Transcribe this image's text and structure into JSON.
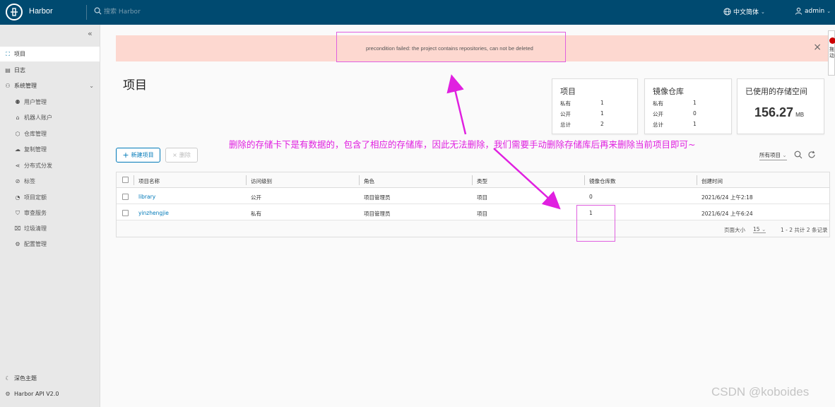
{
  "header": {
    "brand": "Harbor",
    "search_placeholder": "搜索 Harbor",
    "language": "中文简体",
    "user": "admin"
  },
  "sidebar": {
    "items": [
      {
        "label": "项目",
        "icon": "projects-icon"
      },
      {
        "label": "日志",
        "icon": "logs-icon"
      },
      {
        "label": "系统管理",
        "icon": "admin-icon"
      },
      {
        "label": "用户管理",
        "icon": "users-icon"
      },
      {
        "label": "机器人账户",
        "icon": "robot-icon"
      },
      {
        "label": "仓库管理",
        "icon": "registry-icon"
      },
      {
        "label": "复制管理",
        "icon": "replication-icon"
      },
      {
        "label": "分布式分发",
        "icon": "distribution-icon"
      },
      {
        "label": "标签",
        "icon": "label-icon"
      },
      {
        "label": "项目定额",
        "icon": "quota-icon"
      },
      {
        "label": "审查服务",
        "icon": "shield-icon"
      },
      {
        "label": "垃圾清理",
        "icon": "trash-icon"
      },
      {
        "label": "配置管理",
        "icon": "gear-icon"
      }
    ],
    "dark_theme": "深色主题",
    "api": "Harbor API V2.0"
  },
  "alert": {
    "message": "precondition failed: the project contains repositories, can not be deleted"
  },
  "page": {
    "title": "项目"
  },
  "cards": {
    "projects": {
      "title": "项目",
      "private_label": "私有",
      "private": "1",
      "public_label": "公开",
      "public": "1",
      "total_label": "总计",
      "total": "2"
    },
    "repos": {
      "title": "镜像仓库",
      "private_label": "私有",
      "private": "1",
      "public_label": "公开",
      "public": "0",
      "total_label": "总计",
      "total": "1"
    },
    "storage": {
      "title": "已使用的存储空间",
      "value": "156.27",
      "unit": "MB"
    }
  },
  "annotation": "删除的存储卡下是有数据的，包含了相应的存储库，因此无法删除，我们需要手动删除存储库后再来删除当前项目即可~",
  "toolbar": {
    "new_project": "新建项目",
    "delete": "删除",
    "filter": "所有项目"
  },
  "table": {
    "columns": [
      "项目名称",
      "访问级别",
      "角色",
      "类型",
      "镜像仓库数",
      "创建时间"
    ],
    "rows": [
      {
        "name": "library",
        "access": "公开",
        "role": "项目管理员",
        "type": "项目",
        "repos": "0",
        "created": "2021/6/24 上午2:18"
      },
      {
        "name": "yinzhengjie",
        "access": "私有",
        "role": "项目管理员",
        "type": "项目",
        "repos": "1",
        "created": "2021/6/24 上午6:24"
      }
    ],
    "footer": {
      "page_size_label": "页面大小",
      "page_size": "15",
      "range": "1 - 2 共计 2 条记录"
    }
  },
  "watermark": "CSDN @koboides",
  "edge_widget": "拖动",
  "colors": {
    "header": "#004a70",
    "accent": "#0079b8",
    "alert_bg": "#fdd8d0",
    "annotation": "#e020e0"
  }
}
